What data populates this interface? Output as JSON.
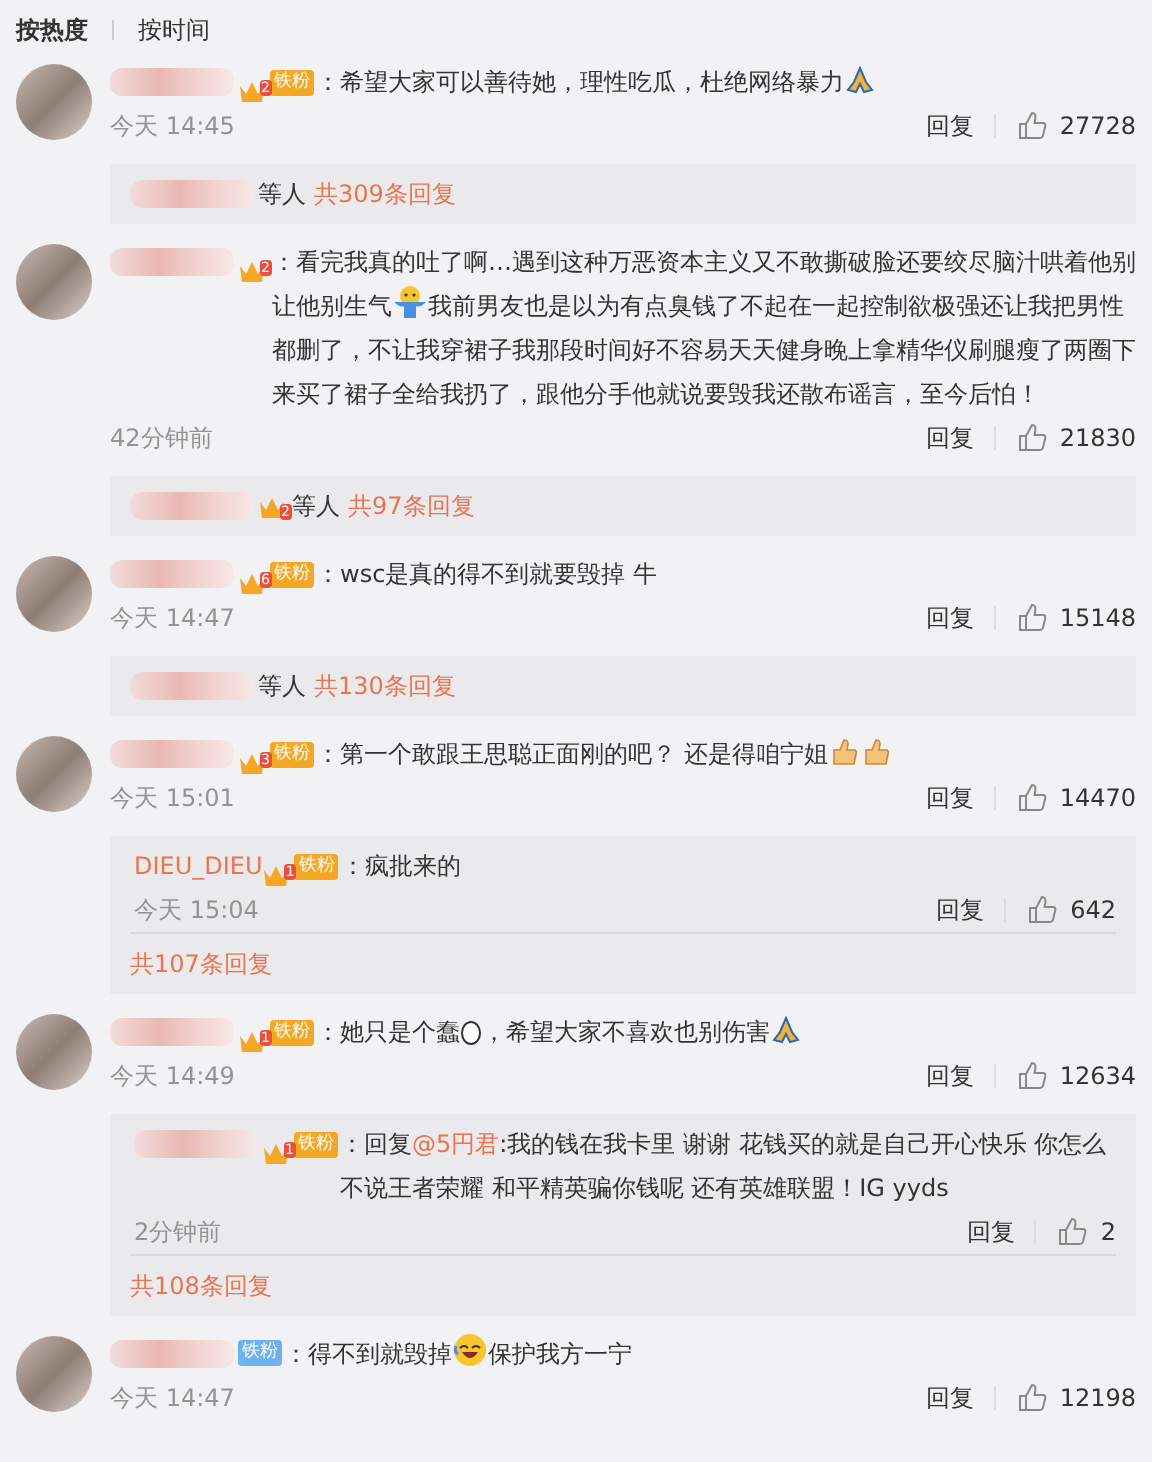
{
  "sort_tabs": [
    {
      "label": "按热度",
      "selected": true
    },
    {
      "label": "按时间",
      "selected": false
    }
  ],
  "comments": [
    {
      "badge": {
        "kind": "crown-fan",
        "level": "2",
        "label": "铁粉"
      },
      "body": [
        {
          "kind": "text",
          "text": "：希望大家可以善待她，理性吃瓜，杜绝网络暴力"
        },
        {
          "kind": "pray"
        }
      ],
      "time": "今天 14:45",
      "reply": "回复",
      "likes": "27728",
      "thread": {
        "kind": "summary",
        "suffix": "等人",
        "total": "共309条回复"
      }
    },
    {
      "badge": {
        "kind": "crown",
        "level": "2"
      },
      "body": [
        {
          "kind": "text",
          "text": "：看完我真的吐了啊…遇到这种万恶资本主义又不敢撕破脸还要绞尽脑汁哄着他别让他别生气"
        },
        {
          "kind": "shrug"
        },
        {
          "kind": "text",
          "text": "我前男友也是以为有点臭钱了不起在一起控制欲极强还让我把男性都删了，不让我穿裙子我那段时间好不容易天天健身晚上拿精华仪刷腿瘦了两圈下来买了裙子全给我扔了，跟他分手他就说要毁我还散布谣言，至今后怕！"
        }
      ],
      "time": "42分钟前",
      "reply": "回复",
      "likes": "21830",
      "thread": {
        "kind": "summary",
        "badge": {
          "kind": "crown",
          "level": "2"
        },
        "suffix": "等人",
        "total": "共97条回复"
      }
    },
    {
      "badge": {
        "kind": "crown-fan",
        "level": "6",
        "label": "铁粉"
      },
      "body": [
        {
          "kind": "text",
          "text": "：wsc是真的得不到就要毁掉 牛"
        }
      ],
      "time": "今天 14:47",
      "reply": "回复",
      "likes": "15148",
      "thread": {
        "kind": "summary",
        "suffix": "等人",
        "total": "共130条回复"
      }
    },
    {
      "badge": {
        "kind": "crown-fan",
        "level": "3",
        "label": "铁粉"
      },
      "body": [
        {
          "kind": "text",
          "text": "：第一个敢跟王思聪正面刚的吧？ 还是得咱宁姐"
        },
        {
          "kind": "thumb"
        },
        {
          "kind": "thumb"
        }
      ],
      "time": "今天 15:01",
      "reply": "回复",
      "likes": "14470",
      "thread": {
        "kind": "expanded",
        "replies": [
          {
            "name": "DIEU_DIEU",
            "badge": {
              "kind": "crown-fan",
              "level": "1",
              "label": "铁粉"
            },
            "body": [
              {
                "kind": "text",
                "text": "：疯批来的"
              }
            ],
            "time": "今天 15:04",
            "reply": "回复",
            "likes": "642"
          }
        ],
        "total": "共107条回复"
      }
    },
    {
      "badge": {
        "kind": "crown-fan",
        "level": "1",
        "label": "铁粉"
      },
      "body": [
        {
          "kind": "text",
          "text": "：她只是个蠢"
        },
        {
          "kind": "egg"
        },
        {
          "kind": "text",
          "text": "，希望大家不喜欢也别伤害"
        },
        {
          "kind": "pray"
        }
      ],
      "time": "今天 14:49",
      "reply": "回复",
      "likes": "12634",
      "thread": {
        "kind": "expanded",
        "replies": [
          {
            "badge": {
              "kind": "crown-fan",
              "level": "1",
              "label": "铁粉"
            },
            "body": [
              {
                "kind": "text",
                "text": "：回复"
              },
              {
                "kind": "mention",
                "text": "@5円君"
              },
              {
                "kind": "text",
                "text": ":我的钱在我卡里 谢谢 花钱买的就是自己开心快乐 你怎么不说王者荣耀 和平精英骗你钱呢 还有英雄联盟！IG yyds"
              }
            ],
            "time": "2分钟前",
            "reply": "回复",
            "likes": "2"
          }
        ],
        "total": "共108条回复"
      }
    },
    {
      "badge": {
        "kind": "fan",
        "label": "铁粉"
      },
      "body": [
        {
          "kind": "text",
          "text": "：得不到就毁掉"
        },
        {
          "kind": "laugh"
        },
        {
          "kind": "text",
          "text": "保护我方一宁"
        }
      ],
      "time": "今天 14:47",
      "reply": "回复",
      "likes": "12198"
    }
  ]
}
